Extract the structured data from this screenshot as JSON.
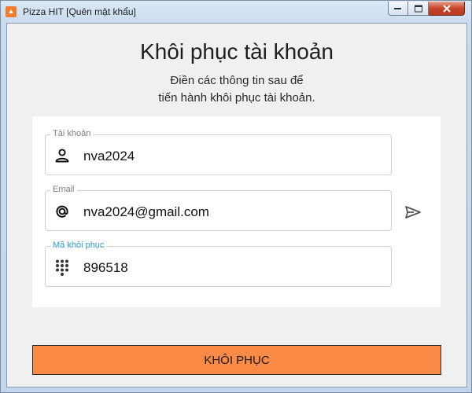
{
  "window": {
    "title": "Pizza HIT [Quên mật khẩu]",
    "accent": "#F07C2A"
  },
  "page": {
    "heading": "Khôi phục tài khoản",
    "subtitle_line1": "Điền các thông tin sau để",
    "subtitle_line2": "tiến hành khôi phục tài khoản."
  },
  "form": {
    "account": {
      "label": "Tài khoản",
      "value": "nva2024",
      "icon": "person-icon"
    },
    "email": {
      "label": "Email",
      "value": "nva2024@gmail.com",
      "icon": "at-icon",
      "send_icon": "send-icon"
    },
    "code": {
      "label": "Mã khôi phục",
      "value": "896518",
      "icon": "dialpad-icon",
      "label_color": "#2B9BD2"
    }
  },
  "submit": {
    "label": "KHÔI PHỤC",
    "color": "#FA8A45"
  }
}
